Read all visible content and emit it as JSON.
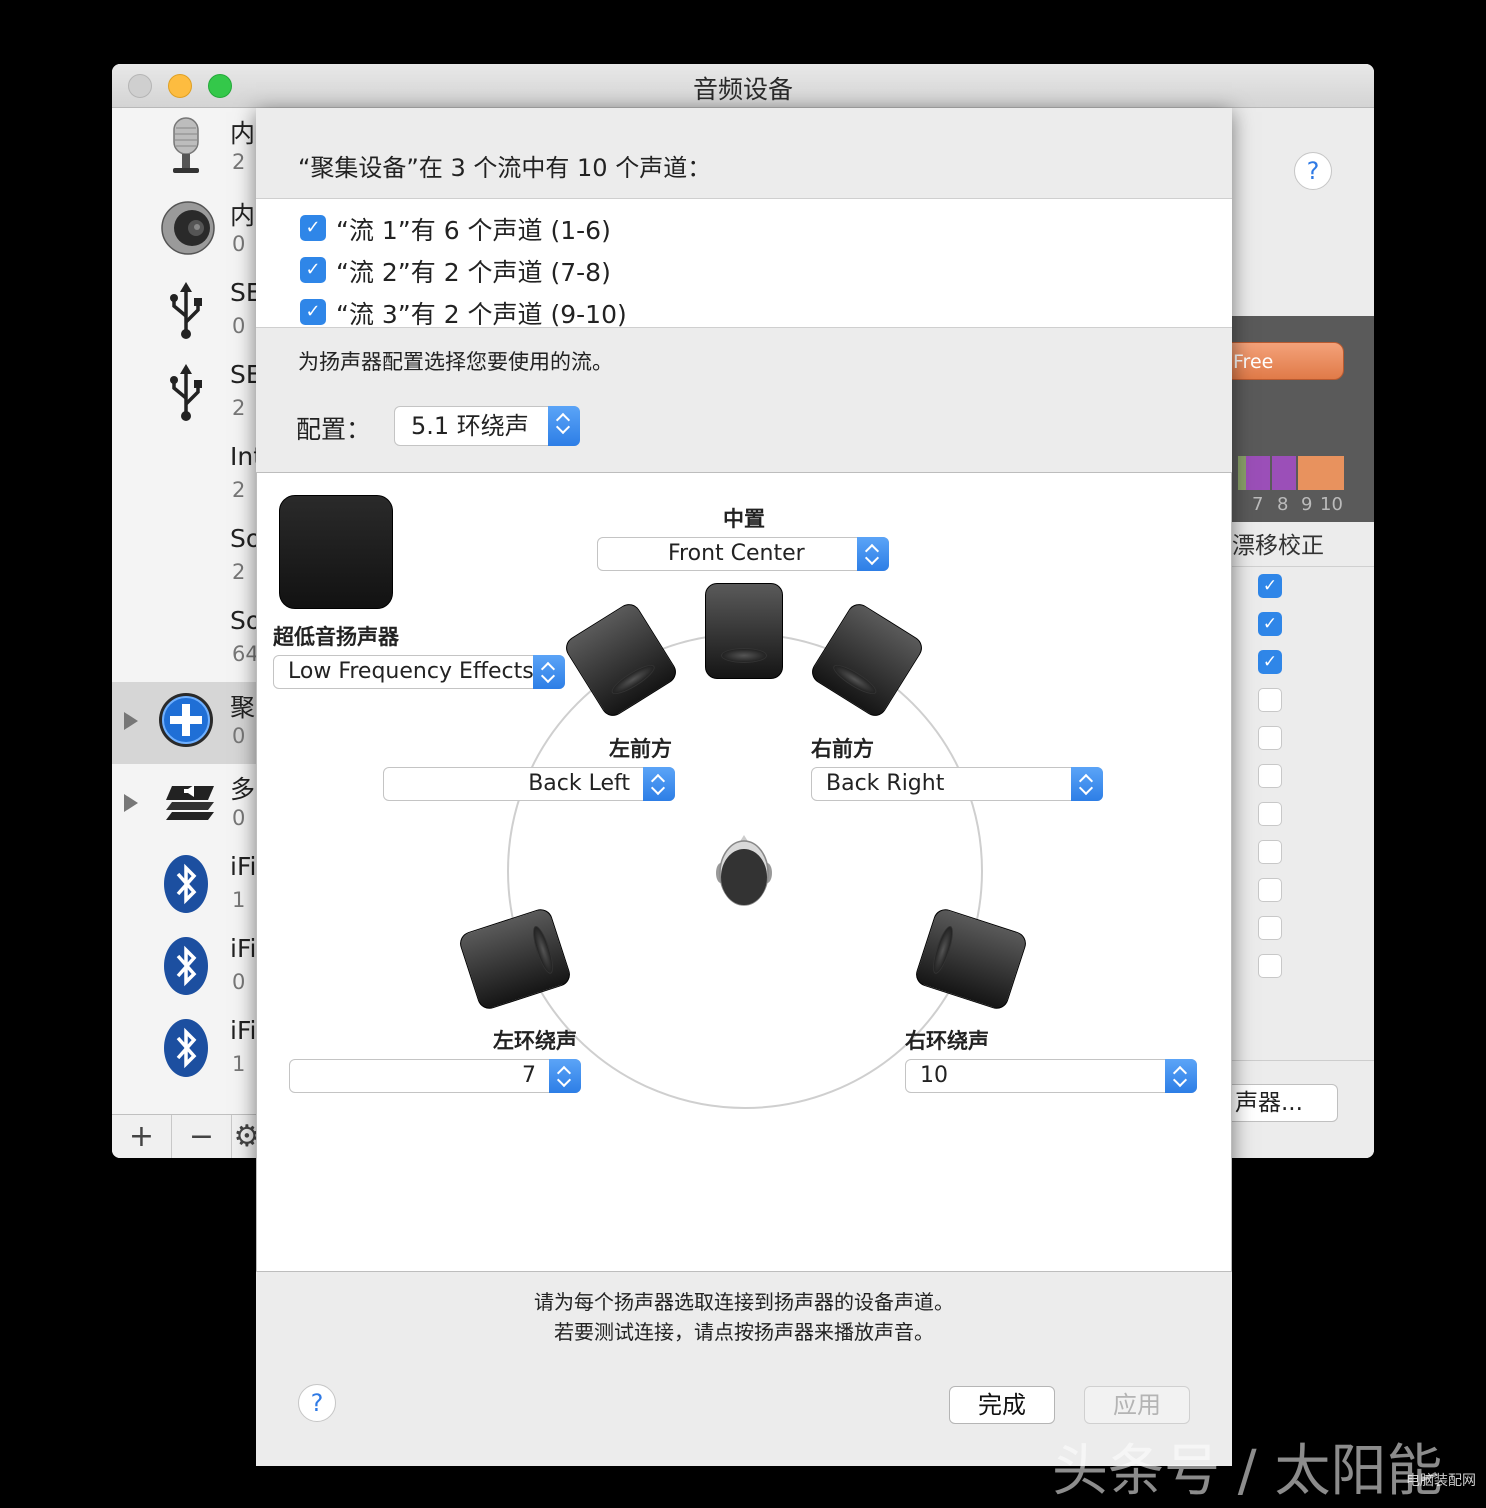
{
  "window": {
    "title": "音频设备"
  },
  "sidebar": {
    "devices": [
      {
        "icon": "microphone-icon",
        "name": "内",
        "sub": "2"
      },
      {
        "icon": "speaker-icon",
        "name": "内",
        "sub": "0"
      },
      {
        "icon": "usb-icon",
        "name": "SE",
        "sub": "0"
      },
      {
        "icon": "usb-icon",
        "name": "SE",
        "sub": "2"
      },
      {
        "icon": "",
        "name": "Int",
        "sub": "2"
      },
      {
        "icon": "",
        "name": "So",
        "sub": "2"
      },
      {
        "icon": "",
        "name": "So",
        "sub": "64"
      },
      {
        "icon": "aggregate-plus-icon",
        "name": "聚",
        "sub": "0",
        "selected": true
      },
      {
        "icon": "multi-output-icon",
        "name": "多",
        "sub": "0"
      },
      {
        "icon": "bluetooth-icon",
        "name": "iFi",
        "sub": "1"
      },
      {
        "icon": "bluetooth-icon",
        "name": "iFi",
        "sub": "0"
      },
      {
        "icon": "bluetooth-icon",
        "name": "iFi",
        "sub": "1"
      }
    ],
    "add_label": "+",
    "remove_label": "−",
    "gear_label": "⚙"
  },
  "right_panel": {
    "help_label": "?",
    "free_label": "Free",
    "channel_numbers": [
      "7",
      "8",
      "9",
      "10"
    ],
    "drift_label": "漂移校正",
    "drift_checks": [
      true,
      true,
      true,
      false,
      false,
      false,
      false,
      false,
      false,
      false,
      false
    ],
    "speaker_button_label": "声器..."
  },
  "sheet": {
    "heading": "“聚集设备”在 3 个流中有 10 个声道：",
    "streams": [
      {
        "checked": true,
        "label": "“流 1”有 6 个声道 (1-6)"
      },
      {
        "checked": true,
        "label": "“流 2”有 2 个声道 (7-8)"
      },
      {
        "checked": true,
        "label": "“流 3”有 2 个声道 (9-10)"
      }
    ],
    "stream_hint": "为扬声器配置选择您要使用的流。",
    "config_label": "配置：",
    "config_value": "5.1 环绕声",
    "speakers": {
      "center": {
        "label": "中置",
        "value": "Front Center"
      },
      "subwoofer": {
        "label": "超低音扬声器",
        "value": "Low Frequency Effects"
      },
      "front_left": {
        "label": "左前方",
        "value": "Back Left"
      },
      "front_right": {
        "label": "右前方",
        "value": "Back Right"
      },
      "surround_left": {
        "label": "左环绕声",
        "value": "7"
      },
      "surround_right": {
        "label": "右环绕声",
        "value": "10"
      }
    },
    "instruction_1": "请为每个扬声器选取连接到扬声器的设备声道。",
    "instruction_2": "若要测试连接，请点按扬声器来播放声音。",
    "help_label": "?",
    "done_label": "完成",
    "apply_label": "应用"
  },
  "watermark": {
    "text": "头条号 / 太阳能",
    "site": "电脑装配网"
  },
  "colors": {
    "accent": "#2f86e8",
    "close": "#fc605c",
    "minimize": "#fdbc40",
    "zoom": "#34c84a"
  }
}
